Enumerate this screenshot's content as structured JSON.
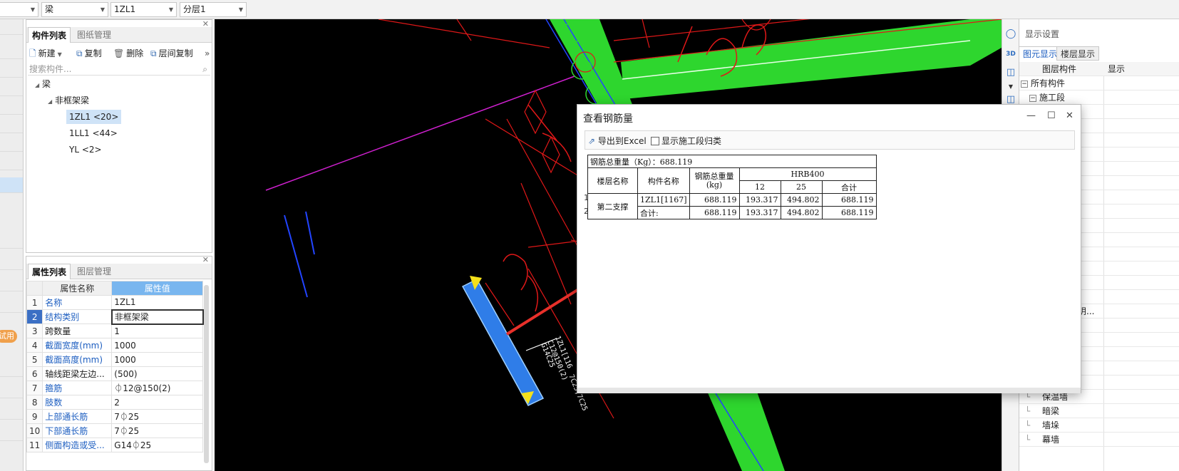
{
  "toolbar": {
    "dropdown1": "",
    "dropdown2": "梁",
    "dropdown3": "1ZL1",
    "dropdown4": "分层1"
  },
  "left_strip": {
    "trial_badge": "试用"
  },
  "component_panel": {
    "tabs": [
      "构件列表",
      "图纸管理"
    ],
    "actions": {
      "new": "新建",
      "copy": "复制",
      "delete": "删除",
      "floor_copy": "层间复制"
    },
    "search_placeholder": "搜索构件...",
    "tree": {
      "root": "梁",
      "group": "非框架梁",
      "items": [
        "1ZL1 <20>",
        "1LL1 <44>",
        "YL <2>"
      ]
    }
  },
  "property_panel": {
    "tabs": [
      "属性列表",
      "图层管理"
    ],
    "header": {
      "name": "属性名称",
      "value": "属性值"
    },
    "rows": [
      {
        "n": "1",
        "name": "名称",
        "value": "1ZL1"
      },
      {
        "n": "2",
        "name": "结构类别",
        "value": "非框架梁"
      },
      {
        "n": "3",
        "name": "跨数量",
        "value": "1"
      },
      {
        "n": "4",
        "name": "截面宽度(mm)",
        "value": "1000"
      },
      {
        "n": "5",
        "name": "截面高度(mm)",
        "value": "1000"
      },
      {
        "n": "6",
        "name": "轴线距梁左边...",
        "value": "(500)"
      },
      {
        "n": "7",
        "name": "箍筋",
        "value": "⏀12@150(2)"
      },
      {
        "n": "8",
        "name": "肢数",
        "value": "2"
      },
      {
        "n": "9",
        "name": "上部通长筋",
        "value": "7⏀25"
      },
      {
        "n": "10",
        "name": "下部通长筋",
        "value": "7⏀25"
      },
      {
        "n": "11",
        "name": "侧面构造或受...",
        "value": "G14⏀25"
      }
    ]
  },
  "cad": {
    "labels": [
      "1ZL1[116",
      "C12@150(2)",
      "G14C25",
      "7C25;7C25"
    ]
  },
  "display_panel": {
    "title": "显示设置",
    "tabs": [
      "图元显示",
      "楼层显示"
    ],
    "columns": [
      "图层构件",
      "显示"
    ],
    "items": [
      "所有构件",
      "施工段",
      "阴...",
      "保温墙",
      "暗梁",
      "墙垛",
      "幕墙"
    ]
  },
  "dialog": {
    "title": "查看钢筋量",
    "export_label": "导出到Excel",
    "show_stage_label": "显示施工段归类",
    "report": {
      "total_caption": "钢筋总重量（Kg）：688.119",
      "headers": {
        "floor": "楼层名称",
        "component": "构件名称",
        "total_weight": "钢筋总重量(kg)",
        "grade": "HRB400",
        "d12": "12",
        "d25": "25",
        "sum": "合计"
      },
      "floor_name": "第二支撑",
      "rows": [
        {
          "num": "1",
          "component": "1ZL1[1167]",
          "total": "688.119",
          "d12": "193.317",
          "d25": "494.802",
          "sum": "688.119"
        },
        {
          "num": "2",
          "component": "合计:",
          "total": "688.119",
          "d12": "193.317",
          "d25": "494.802",
          "sum": "688.119"
        }
      ]
    }
  },
  "colors": {
    "accent": "#1d5ec0",
    "cad_background": "#000000",
    "beam_green": "#2ed62e",
    "beam_blue": "#2f7de8",
    "cad_red": "#e01818",
    "annotation_arrow": "#e8302a"
  }
}
